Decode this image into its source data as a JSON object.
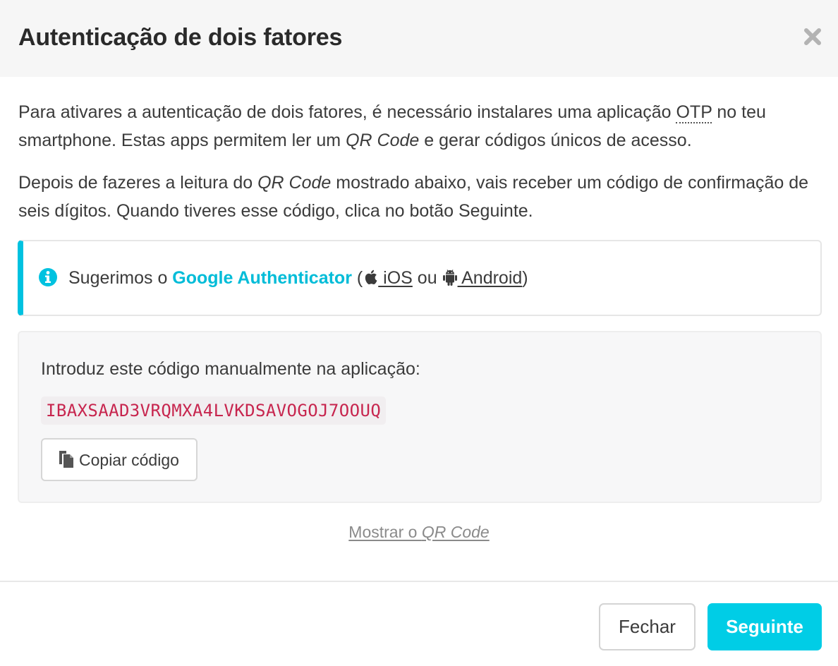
{
  "dialog": {
    "title": "Autenticação de dois fatores",
    "close_icon": "close-icon"
  },
  "intro": {
    "p1_before": "Para ativares a autenticação de dois fatores, é necessário instalares uma aplicação ",
    "p1_abbr": "OTP",
    "p1_middle": " no teu smartphone. Estas apps permitem ler um ",
    "p1_em": "QR Code",
    "p1_after": " e gerar códigos únicos de acesso.",
    "p2_before": "Depois de fazeres a leitura do ",
    "p2_em": "QR Code",
    "p2_after": " mostrado abaixo, vais receber um código de confirmação de seis dígitos. Quando tiveres esse código, clica no botão Seguinte."
  },
  "callout": {
    "icon": "info-circle-icon",
    "text_before": "Sugerimos o ",
    "app_name": "Google Authenticator",
    "open_paren": " (",
    "ios_icon": "apple-icon",
    "ios_label": " iOS",
    "separator": " ou ",
    "android_icon": "android-icon",
    "android_label": " Android",
    "close_paren": ")",
    "accent_color": "#00c2e0"
  },
  "manual_code": {
    "label": "Introduz este código manualmente na aplicação:",
    "code": "IBAXSAAD3VRQMXA4LVKDSAVOGOJ7OOUQ",
    "copy_icon": "copy-icon",
    "copy_label": "Copiar código",
    "code_color": "#c7254e"
  },
  "qr_link": {
    "before": "Mostrar o ",
    "em": "QR Code"
  },
  "footer": {
    "close_label": "Fechar",
    "next_label": "Seguinte",
    "primary_color": "#00cde6"
  }
}
